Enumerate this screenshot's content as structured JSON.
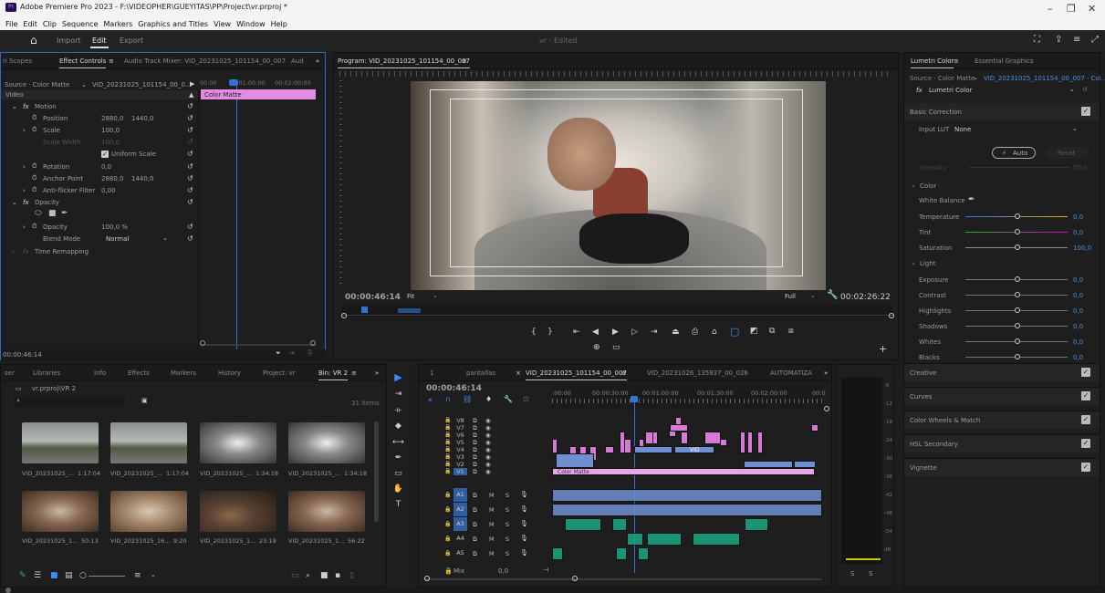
{
  "window": {
    "title": "Adobe Premiere Pro 2023 - F:\\VIDEOPHER\\GUEYITAS\\PP\\Project\\vr.prproj *",
    "logo_text": "Pr",
    "controls": [
      "–",
      "❐",
      "✕"
    ]
  },
  "menu": [
    "File",
    "Edit",
    "Clip",
    "Sequence",
    "Markers",
    "Graphics and Titles",
    "View",
    "Window",
    "Help"
  ],
  "workspace": {
    "tabs": [
      "Import",
      "Edit",
      "Export"
    ],
    "active": "Edit",
    "doc_title": "vr - Edited"
  },
  "effect_controls": {
    "tabs": [
      "ri Scopes",
      "Effect Controls",
      "Audio Track Mixer: VID_20231025_101154_00_007",
      "Aud"
    ],
    "source_label": "Source · Color Matte",
    "source_clip": "VID_20231025_101154_00_0...",
    "mini_time_start": "00:00",
    "mini_time_mid": "00:01:00:00",
    "mini_time_end": "00:02:00:00",
    "section_video": "Video",
    "clip_bar": "Color Matte",
    "rows": {
      "motion": "Motion",
      "position": "Position",
      "position_x": "2880,0",
      "position_y": "1440,0",
      "scale": "Scale",
      "scale_val": "100,0",
      "scale_width": "Scale Width",
      "scale_width_val": "100,0",
      "uniform_scale": "Uniform Scale",
      "rotation": "Rotation",
      "rotation_val": "0,0",
      "anchor": "Anchor Point",
      "anchor_x": "2880,0",
      "anchor_y": "1440,0",
      "antiflicker": "Anti-flicker Filter",
      "antiflicker_val": "0,00",
      "opacity_fx": "Opacity",
      "opacity": "Opacity",
      "opacity_val": "100,0 %",
      "blend_mode": "Blend Mode",
      "blend_val": "Normal",
      "time_remap": "Time Remapping"
    },
    "timecode": "00:00:46:14"
  },
  "program": {
    "title": "Program: VID_20231025_101154_00_007",
    "timecode": "00:00:46:14",
    "fit": "Fit",
    "quality": "Full",
    "duration": "00:02:26:22"
  },
  "project": {
    "tabs": [
      "ser",
      "Libraries",
      "Info",
      "Effects",
      "Markers",
      "History",
      "Project: vr",
      "Bin: VR 2"
    ],
    "path": "vr.prproj\\VR 2",
    "items_count": "31 items",
    "clips": [
      {
        "name": "VID_20231025_...",
        "dur": "1:17:04"
      },
      {
        "name": "VID_20231025_...",
        "dur": "1:17:04"
      },
      {
        "name": "VID_20231025_...",
        "dur": "1:34:18"
      },
      {
        "name": "VID_20231025_...",
        "dur": "1:34:18"
      },
      {
        "name": "VID_20231025_1...",
        "dur": "50:13"
      },
      {
        "name": "VID_20231025_16...",
        "dur": "9:20"
      },
      {
        "name": "VID_20231025_1...",
        "dur": "23:19"
      },
      {
        "name": "VID_20231025_1...",
        "dur": "56:22"
      }
    ]
  },
  "timeline": {
    "tabs": [
      "1",
      "pantallas",
      "VID_20231025_101154_00_007",
      "VID_20231026_135837_00_026",
      "AUTOMATIZA"
    ],
    "timecode": "00:00:46:14",
    "ruler": [
      ":00:00",
      "00:00:30:00",
      "00:01:00:00",
      "00:01:30:00",
      "00:02:00:00",
      "00:0"
    ],
    "video_tracks": [
      "V8",
      "V7",
      "V6",
      "V5",
      "V4",
      "V3",
      "V2",
      "V1"
    ],
    "audio_tracks": [
      "A1",
      "A2",
      "A3",
      "A4",
      "A5"
    ],
    "mix_label": "Mix",
    "mix_val": "0,0",
    "color_matte_label": "Color Matte",
    "vid_label": "VID"
  },
  "meter_scale": [
    "-6",
    "-12",
    "-18",
    "-24",
    "-30",
    "-36",
    "-42",
    "-48",
    "-54",
    "dB"
  ],
  "meter_solo": [
    "S",
    "S"
  ],
  "lumetri": {
    "tabs": [
      "Lumetri Color",
      "Essential Graphics"
    ],
    "source": "Source · Color Matte",
    "source_clip": "VID_20231025_101154_00_007 · Col...",
    "fx_name": "Lumetri Color",
    "basic": "Basic Correction",
    "input_lut": "Input LUT",
    "lut_val": "None",
    "auto": "Auto",
    "reset": "Reset",
    "intensity": "Intensity",
    "intensity_val": "50,0",
    "color": "Color",
    "white_balance": "White Balance",
    "sliders": [
      {
        "name": "Temperature",
        "val": "0,0"
      },
      {
        "name": "Tint",
        "val": "0,0"
      },
      {
        "name": "Saturation",
        "val": "100,0"
      }
    ],
    "light": "Light",
    "light_sliders": [
      {
        "name": "Exposure",
        "val": "0,0"
      },
      {
        "name": "Contrast",
        "val": "0,0"
      },
      {
        "name": "Highlights",
        "val": "0,0"
      },
      {
        "name": "Shadows",
        "val": "0,0"
      },
      {
        "name": "Whites",
        "val": "0,0"
      },
      {
        "name": "Blacks",
        "val": "0,0"
      }
    ],
    "sections": [
      "Creative",
      "Curves",
      "Color Wheels & Match",
      "HSL Secondary",
      "Vignette"
    ]
  }
}
